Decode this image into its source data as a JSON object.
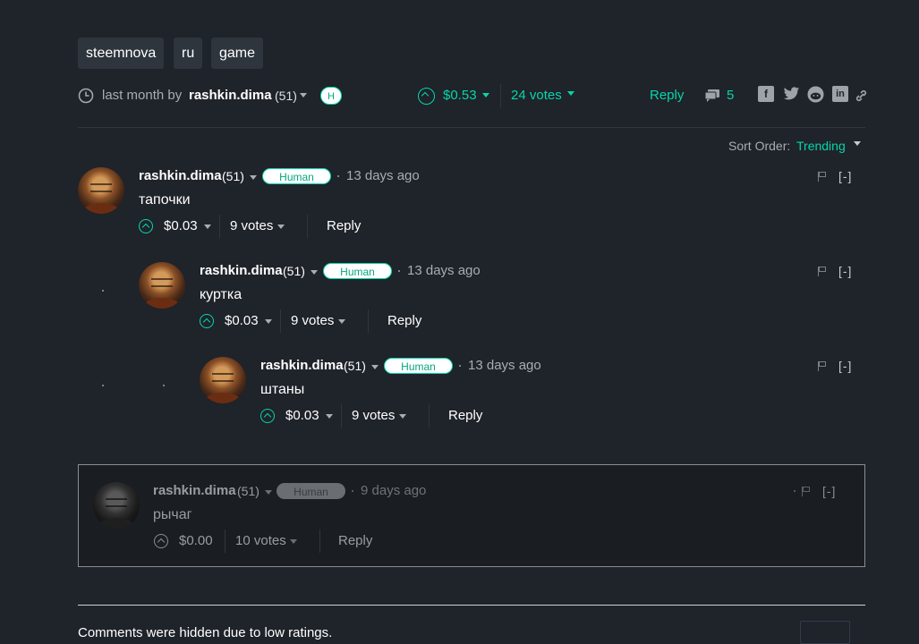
{
  "tags": [
    "steemnova",
    "ru",
    "game"
  ],
  "post_meta": {
    "time": "last month by",
    "author": "rashkin.dima",
    "rep": "(51)",
    "badge": "H",
    "payout": "$0.53",
    "votes": "24 votes",
    "reply": "Reply",
    "comment_count": "5"
  },
  "sort": {
    "label": "Sort Order:",
    "value": "Trending"
  },
  "comments": [
    {
      "author": "rashkin.dima",
      "rep": "(51)",
      "badge": "Human",
      "when": "13 days ago",
      "body": "тапочки",
      "payout": "$0.03",
      "votes": "9 votes",
      "reply": "Reply",
      "collapse": "[-]"
    },
    {
      "author": "rashkin.dima",
      "rep": "(51)",
      "badge": "Human",
      "when": "13 days ago",
      "body": "куртка",
      "payout": "$0.03",
      "votes": "9 votes",
      "reply": "Reply",
      "collapse": "[-]"
    },
    {
      "author": "rashkin.dima",
      "rep": "(51)",
      "badge": "Human",
      "when": "13 days ago",
      "body": "штаны",
      "payout": "$0.03",
      "votes": "9 votes",
      "reply": "Reply",
      "collapse": "[-]"
    },
    {
      "author": "rashkin.dima",
      "rep": "(51)",
      "badge": "Human",
      "when": "9 days ago",
      "body": "рычаг",
      "payout": "$0.00",
      "votes": "10 votes",
      "reply": "Reply",
      "collapse": "[-]"
    }
  ],
  "footer": {
    "hidden_notice": "Comments were hidden due to low ratings."
  },
  "colors": {
    "accent": "#06d6a9",
    "background": "#1f232a"
  },
  "icons": [
    "clock-icon",
    "upvote-icon",
    "comment-icon",
    "facebook-icon",
    "twitter-icon",
    "reddit-icon",
    "linkedin-icon",
    "link-icon",
    "flag-icon"
  ]
}
